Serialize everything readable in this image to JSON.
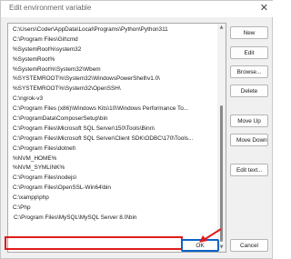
{
  "window": {
    "title": "Edit environment variable",
    "close_glyph": "✕"
  },
  "list": {
    "items": [
      "C:\\Users\\Coder\\AppData\\Local\\Programs\\Python\\Python311",
      "C:\\Program Files\\Git\\cmd",
      "%SystemRoot%\\system32",
      "%SystemRoot%",
      "%SystemRoot%\\System32\\Wbem",
      "%SYSTEMROOT%\\System32\\WindowsPowerShell\\v1.0\\",
      "%SYSTEMROOT%\\System32\\OpenSSH\\",
      "C:\\ngrok-v3",
      "C:\\Program Files (x86)\\Windows Kits\\10\\Windows Performance To...",
      "C:\\ProgramData\\ComposerSetup\\bin",
      "C:\\Program Files\\Microsoft SQL Server\\150\\Tools\\Binn\\",
      "C:\\Program Files\\Microsoft SQL Server\\Client SDK\\ODBC\\170\\Tools...",
      "C:\\Program Files\\dotnet\\",
      "%NVM_HOME%",
      "%NVM_SYMLINK%",
      "C:\\Program Files\\nodejs\\",
      "C:\\Program Files\\OpenSSL-Win64\\bin",
      "C:\\xampp\\php",
      "C:\\Php",
      "C:\\Program Files\\MySQL\\MySQL Server 8.0\\bin"
    ],
    "selected_index": 19
  },
  "buttons": {
    "new": "New",
    "edit": "Edit",
    "browse": "Browse...",
    "delete": "Delete",
    "move_up": "Move Up",
    "move_down": "Move Down",
    "edit_text": "Edit text...",
    "ok": "OK",
    "cancel": "Cancel"
  },
  "colors": {
    "highlight": "#e01b1b",
    "ok_border": "#0a64c8",
    "arrow": "#e01b1b"
  }
}
